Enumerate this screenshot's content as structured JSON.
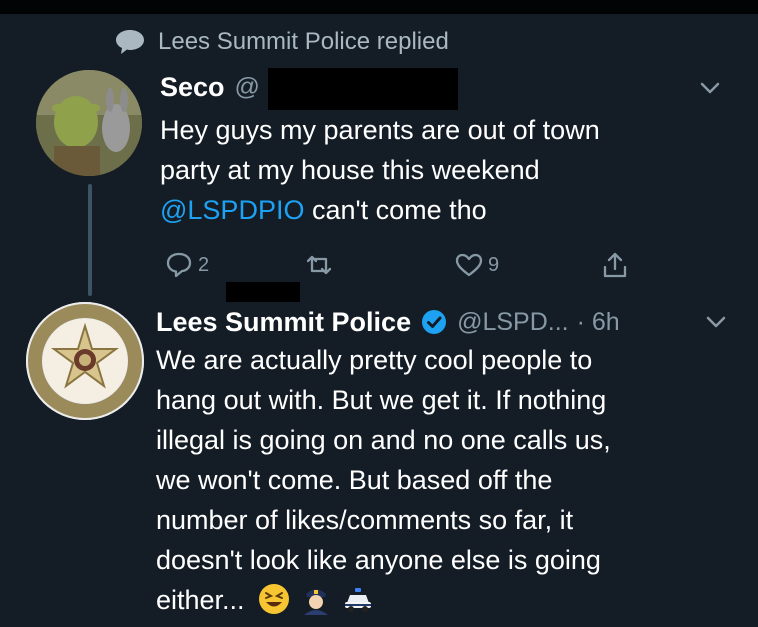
{
  "reply_context": {
    "label": "Lees Summit Police replied",
    "icon": "speech-bubble-icon"
  },
  "tweet1": {
    "name": "Seco",
    "handle": "@",
    "text_line1": "Hey guys my parents are out of town",
    "text_line2": "party at my house this weekend",
    "mention": "@LSPDPIO",
    "text_after_mention": " can't come tho",
    "reply_count": "2",
    "like_count": "9"
  },
  "tweet2": {
    "name": "Lees Summit Police",
    "handle": "@LSPD...",
    "time": "· 6h",
    "text": "We are actually pretty cool people to\nhang out with.  But we get it.  If nothing\nillegal is going on and no one calls us,\nwe won't come.  But based off the\nnumber of likes/comments so far, it\ndoesn't look like anyone else is going\neither...",
    "emojis": [
      "grinning-squint-emoji",
      "police-officer-emoji",
      "police-car-emoji"
    ]
  },
  "colors": {
    "background": "#141d26",
    "muted": "#8899a6",
    "link": "#1da1f2",
    "verified": "#1da1f2"
  }
}
